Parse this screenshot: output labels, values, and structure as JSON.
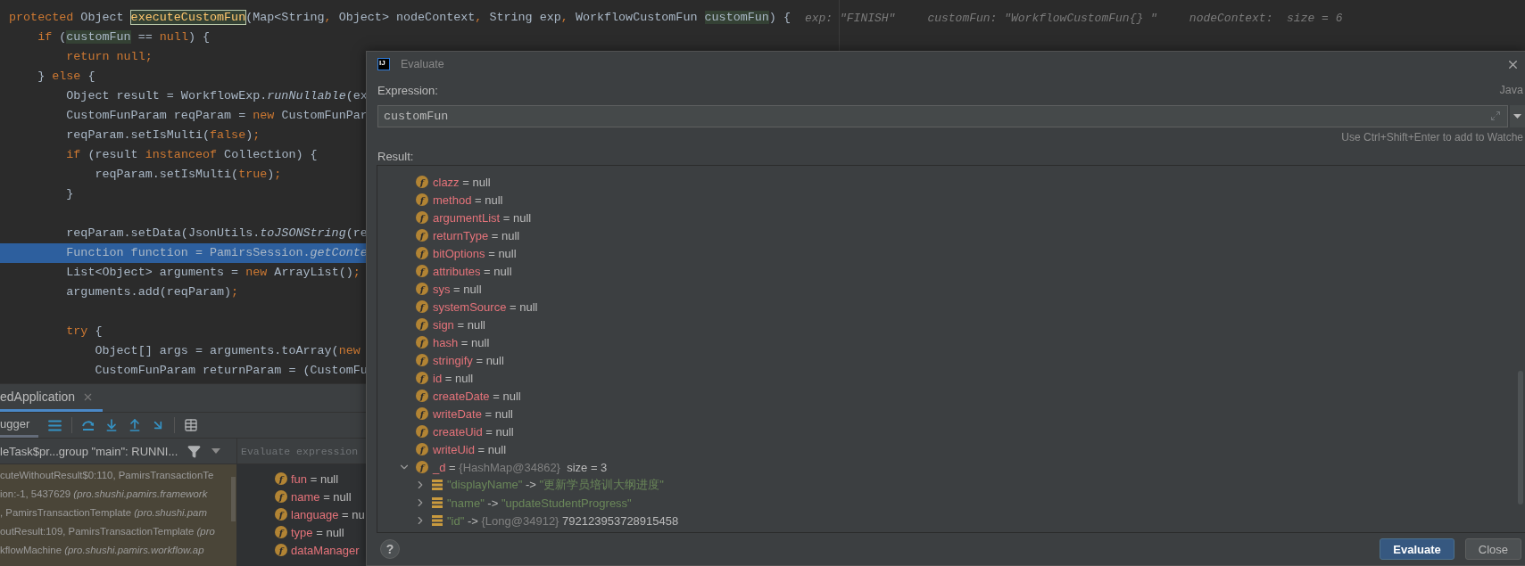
{
  "editor": {
    "lines": [
      {
        "selected": false,
        "segments": [
          {
            "text": "protected ",
            "kind": "keyword"
          },
          {
            "text": "Object ",
            "kind": "plain"
          },
          {
            "text": "executeCustomFun",
            "kind": "usage"
          },
          {
            "text": "(Map<String",
            "kind": "plain"
          },
          {
            "text": ", ",
            "kind": "keyword"
          },
          {
            "text": "Object> nodeContext",
            "kind": "plain"
          },
          {
            "text": ", ",
            "kind": "keyword"
          },
          {
            "text": "String exp",
            "kind": "plain"
          },
          {
            "text": ", ",
            "kind": "keyword"
          },
          {
            "text": "WorkflowCustomFun ",
            "kind": "plain"
          },
          {
            "text": "customFun",
            "kind": "ref"
          },
          {
            "text": ") {",
            "kind": "plain"
          }
        ],
        "hints": [
          "exp: \"FINISH\"",
          "customFun: \"WorkflowCustomFun{} \"",
          "nodeContext:  size = 6"
        ]
      },
      {
        "selected": false,
        "segments": [
          {
            "text": "    if ",
            "kind": "keyword"
          },
          {
            "text": "(",
            "kind": "plain"
          },
          {
            "text": "customFun",
            "kind": "ref"
          },
          {
            "text": " == ",
            "kind": "plain"
          },
          {
            "text": "null",
            "kind": "keyword"
          },
          {
            "text": ") {",
            "kind": "plain"
          }
        ]
      },
      {
        "selected": false,
        "segments": [
          {
            "text": "        return null;",
            "kind": "keyword"
          }
        ]
      },
      {
        "selected": false,
        "segments": [
          {
            "text": "    } ",
            "kind": "plain"
          },
          {
            "text": "else ",
            "kind": "keyword"
          },
          {
            "text": "{",
            "kind": "plain"
          }
        ]
      },
      {
        "selected": false,
        "segments": [
          {
            "text": "        Object result = WorkflowExp.",
            "kind": "plain"
          },
          {
            "text": "runNullable",
            "kind": "static"
          },
          {
            "text": "(ex",
            "kind": "plain"
          }
        ]
      },
      {
        "selected": false,
        "segments": [
          {
            "text": "        CustomFunParam reqParam = ",
            "kind": "plain"
          },
          {
            "text": "new ",
            "kind": "keyword"
          },
          {
            "text": "CustomFunPar",
            "kind": "plain"
          }
        ]
      },
      {
        "selected": false,
        "segments": [
          {
            "text": "        reqParam.setIsMulti(",
            "kind": "plain"
          },
          {
            "text": "false",
            "kind": "keyword"
          },
          {
            "text": ")",
            "kind": "plain"
          },
          {
            "text": ";",
            "kind": "keyword"
          }
        ]
      },
      {
        "selected": false,
        "segments": [
          {
            "text": "        if ",
            "kind": "keyword"
          },
          {
            "text": "(result ",
            "kind": "plain"
          },
          {
            "text": "instanceof ",
            "kind": "keyword"
          },
          {
            "text": "Collection) {",
            "kind": "plain"
          }
        ]
      },
      {
        "selected": false,
        "segments": [
          {
            "text": "            reqParam.setIsMulti(",
            "kind": "plain"
          },
          {
            "text": "true",
            "kind": "keyword"
          },
          {
            "text": ")",
            "kind": "plain"
          },
          {
            "text": ";",
            "kind": "keyword"
          }
        ]
      },
      {
        "selected": false,
        "segments": [
          {
            "text": "        }",
            "kind": "plain"
          }
        ]
      },
      {
        "selected": false
      },
      {
        "selected": false,
        "segments": [
          {
            "text": "        reqParam.setData(JsonUtils.",
            "kind": "plain"
          },
          {
            "text": "toJSONString",
            "kind": "static"
          },
          {
            "text": "(re",
            "kind": "plain"
          }
        ]
      },
      {
        "selected": true,
        "segments": [
          {
            "text": "        Function function = PamirsSession.",
            "kind": "plain"
          },
          {
            "text": "getConte",
            "kind": "static"
          }
        ]
      },
      {
        "selected": false,
        "segments": [
          {
            "text": "        List<Object> arguments = ",
            "kind": "plain"
          },
          {
            "text": "new ",
            "kind": "keyword"
          },
          {
            "text": "ArrayList()",
            "kind": "plain"
          },
          {
            "text": ";",
            "kind": "keyword"
          }
        ]
      },
      {
        "selected": false,
        "segments": [
          {
            "text": "        arguments.add(reqParam)",
            "kind": "plain"
          },
          {
            "text": ";",
            "kind": "keyword"
          }
        ]
      },
      {
        "selected": false
      },
      {
        "selected": false,
        "segments": [
          {
            "text": "        try ",
            "kind": "keyword"
          },
          {
            "text": "{",
            "kind": "plain"
          }
        ]
      },
      {
        "selected": false,
        "segments": [
          {
            "text": "            Object[] args = arguments.toArray(",
            "kind": "plain"
          },
          {
            "text": "new",
            "kind": "keyword"
          }
        ]
      },
      {
        "selected": false,
        "segments": [
          {
            "text": "            CustomFunParam returnParam = (CustomFu",
            "kind": "plain"
          }
        ]
      }
    ]
  },
  "debug_panel": {
    "tab": {
      "label": "edApplication",
      "selected": true
    },
    "view_tab": {
      "label": "ugger",
      "selected": true
    },
    "thread": "leTask$pr...group \"main\": RUNNI...",
    "frames": [
      "cuteWithoutResult$0:110, PamirsTransactionTe",
      "ion:-1, 5437629 *(pro.shushi.pamirs.framework*",
      ", PamirsTransactionTemplate *(pro.shushi.pam*",
      "outResult:109, PamirsTransactionTemplate *(pro*",
      "kflowMachine *(pro.shushi.pamirs.workflow.ap*"
    ],
    "variables_search": {
      "placeholder": "Evaluate expression"
    },
    "variables": [
      {
        "badge": "f",
        "name": "fun",
        "op": "=",
        "value": "null"
      },
      {
        "badge": "f",
        "name": "name",
        "op": "=",
        "value": "null"
      },
      {
        "badge": "f",
        "name": "language",
        "op": "=",
        "value": "nu"
      },
      {
        "badge": "f",
        "name": "type",
        "op": "=",
        "value": "null"
      },
      {
        "badge": "f",
        "name": "dataManager"
      }
    ]
  },
  "dialog": {
    "logo": "IJ",
    "title": "Evaluate",
    "expression_label": "Expression:",
    "language": "Java",
    "expression": "customFun",
    "hint": "Use Ctrl+Shift+Enter to add to Watche",
    "result_label": "Result:",
    "result": [
      {
        "kind": "field",
        "badge": "f",
        "name": "clazz",
        "op": "=",
        "value": "null"
      },
      {
        "kind": "field",
        "badge": "f",
        "name": "method",
        "op": "=",
        "value": "null"
      },
      {
        "kind": "field",
        "badge": "f",
        "name": "argumentList",
        "op": "=",
        "value": "null"
      },
      {
        "kind": "field",
        "badge": "f",
        "name": "returnType",
        "op": "=",
        "value": "null"
      },
      {
        "kind": "field",
        "badge": "f",
        "name": "bitOptions",
        "op": "=",
        "value": "null"
      },
      {
        "kind": "field",
        "badge": "f",
        "name": "attributes",
        "op": "=",
        "value": "null"
      },
      {
        "kind": "field",
        "badge": "f",
        "name": "sys",
        "op": "=",
        "value": "null"
      },
      {
        "kind": "field",
        "badge": "f",
        "name": "systemSource",
        "op": "=",
        "value": "null"
      },
      {
        "kind": "field",
        "badge": "f",
        "name": "sign",
        "op": "=",
        "value": "null"
      },
      {
        "kind": "field",
        "badge": "f",
        "name": "hash",
        "op": "=",
        "value": "null"
      },
      {
        "kind": "field",
        "badge": "f",
        "name": "stringify",
        "op": "=",
        "value": "null"
      },
      {
        "kind": "field",
        "badge": "f",
        "name": "id",
        "op": "=",
        "value": "null"
      },
      {
        "kind": "field",
        "badge": "f",
        "name": "createDate",
        "op": "=",
        "value": "null"
      },
      {
        "kind": "field",
        "badge": "f",
        "name": "writeDate",
        "op": "=",
        "value": "null"
      },
      {
        "kind": "field",
        "badge": "f",
        "name": "createUid",
        "op": "=",
        "value": "null"
      },
      {
        "kind": "field",
        "badge": "f",
        "name": "writeUid",
        "op": "=",
        "value": "null"
      },
      {
        "kind": "field",
        "badge": "f",
        "name": "_d",
        "expanded": true,
        "op": "=",
        "type_ref": "{HashMap@34862}",
        "value": "size = 3",
        "children": [
          {
            "kind": "string",
            "expanded": false,
            "name": "\"displayName\"",
            "op": "->",
            "value": "\"更新学员培训大纲进度\""
          },
          {
            "kind": "string",
            "expanded": false,
            "name": "\"name\"",
            "op": "->",
            "value": "\"updateStudentProgress\""
          },
          {
            "kind": "object",
            "expanded": false,
            "name": "\"id\"",
            "op": "->",
            "type_ref": "{Long@34912}",
            "value": "792123953728915458"
          }
        ]
      }
    ],
    "help": "?",
    "buttons": [
      {
        "label": "Evaluate",
        "kind": "primary"
      },
      {
        "label": "Close",
        "kind": "secondary"
      }
    ]
  }
}
